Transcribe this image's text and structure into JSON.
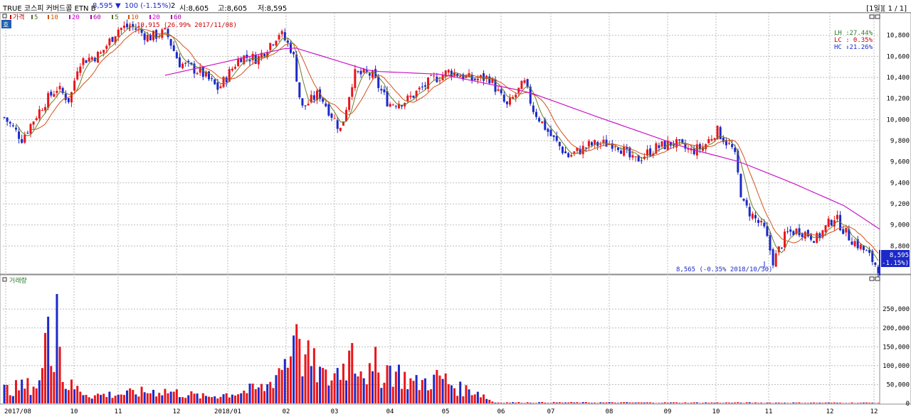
{
  "header": {
    "name": "TRUE 코스피 커버드콜 ETN B",
    "price": "8,595",
    "change_arrow": "▼",
    "change": "100 (-1.15%)",
    "count": "2",
    "open": "시:8,605",
    "high": "고:8,605",
    "low": "저:8,595",
    "period": "[1일][ 1 / 1]"
  },
  "price_panel": {
    "legend": [
      {
        "label": "가격",
        "color": "#cc0000"
      },
      {
        "label": "5",
        "color": "#556b2f"
      },
      {
        "label": "10",
        "color": "#cc5500"
      },
      {
        "label": "20",
        "color": "#cc00cc"
      },
      {
        "label": "60",
        "color": "#aa00aa"
      },
      {
        "label": "5",
        "color": "#556b2f"
      },
      {
        "label": "10",
        "color": "#cc5500"
      },
      {
        "label": "20",
        "color": "#cc00cc"
      },
      {
        "label": "60",
        "color": "#aa00aa"
      }
    ],
    "small_button": "호",
    "stats": {
      "lh_label": "LH :",
      "lh_value": "27.44%",
      "lc_label": "LC :",
      "lc_value": "0.35%",
      "hc_label": "HC :",
      "hc_value": "-21.26%"
    },
    "high_annotation": "10,915 (26.99% 2017/11/08)",
    "low_annotation": "8,565 (-0.35% 2018/10/30)",
    "current_price_label": "8,595",
    "current_change_label": "(-1.15%)"
  },
  "volume_panel": {
    "title": "거래량"
  },
  "colors": {
    "up": "#e8161b",
    "down": "#1c29c8",
    "ma5": "#6b7d2a",
    "ma10": "#d2531b",
    "ma60": "#c815c8"
  },
  "chart_data": {
    "type": "candlestick",
    "price_axis": {
      "ticks": [
        8800,
        9000,
        9200,
        9400,
        9600,
        9800,
        10000,
        10200,
        10400,
        10600,
        10800
      ],
      "range": [
        8560,
        10960
      ]
    },
    "volume_axis": {
      "ticks": [
        0,
        50000,
        100000,
        150000,
        200000,
        250000
      ],
      "range": [
        0,
        290000
      ]
    },
    "x_labels": [
      "2017/08",
      "10",
      "11",
      "12",
      "2018/01",
      "02",
      "03",
      "04",
      "05",
      "06",
      "07",
      "08",
      "09",
      "10",
      "11",
      "12",
      "12"
    ],
    "price_path": [
      {
        "t": 0,
        "v": 10020
      },
      {
        "t": 0.02,
        "v": 9820
      },
      {
        "t": 0.045,
        "v": 10150
      },
      {
        "t": 0.06,
        "v": 10300
      },
      {
        "t": 0.075,
        "v": 10180
      },
      {
        "t": 0.085,
        "v": 10550
      },
      {
        "t": 0.11,
        "v": 10620
      },
      {
        "t": 0.13,
        "v": 10860
      },
      {
        "t": 0.145,
        "v": 10890
      },
      {
        "t": 0.165,
        "v": 10780
      },
      {
        "t": 0.185,
        "v": 10830
      },
      {
        "t": 0.2,
        "v": 10540
      },
      {
        "t": 0.225,
        "v": 10450
      },
      {
        "t": 0.245,
        "v": 10290
      },
      {
        "t": 0.27,
        "v": 10600
      },
      {
        "t": 0.29,
        "v": 10580
      },
      {
        "t": 0.315,
        "v": 10830
      },
      {
        "t": 0.33,
        "v": 10650
      },
      {
        "t": 0.34,
        "v": 10100
      },
      {
        "t": 0.36,
        "v": 10250
      },
      {
        "t": 0.385,
        "v": 9900
      },
      {
        "t": 0.4,
        "v": 10430
      },
      {
        "t": 0.42,
        "v": 10430
      },
      {
        "t": 0.44,
        "v": 10150
      },
      {
        "t": 0.46,
        "v": 10180
      },
      {
        "t": 0.49,
        "v": 10380
      },
      {
        "t": 0.51,
        "v": 10460
      },
      {
        "t": 0.535,
        "v": 10380
      },
      {
        "t": 0.555,
        "v": 10400
      },
      {
        "t": 0.575,
        "v": 10120
      },
      {
        "t": 0.595,
        "v": 10350
      },
      {
        "t": 0.605,
        "v": 10100
      },
      {
        "t": 0.625,
        "v": 9850
      },
      {
        "t": 0.645,
        "v": 9650
      },
      {
        "t": 0.67,
        "v": 9760
      },
      {
        "t": 0.7,
        "v": 9780
      },
      {
        "t": 0.72,
        "v": 9600
      },
      {
        "t": 0.745,
        "v": 9730
      },
      {
        "t": 0.765,
        "v": 9780
      },
      {
        "t": 0.785,
        "v": 9700
      },
      {
        "t": 0.8,
        "v": 9740
      },
      {
        "t": 0.815,
        "v": 9900
      },
      {
        "t": 0.835,
        "v": 9700
      },
      {
        "t": 0.845,
        "v": 9200
      },
      {
        "t": 0.87,
        "v": 8950
      },
      {
        "t": 0.88,
        "v": 8650
      },
      {
        "t": 0.895,
        "v": 8920
      },
      {
        "t": 0.91,
        "v": 8950
      },
      {
        "t": 0.93,
        "v": 8870
      },
      {
        "t": 0.95,
        "v": 9080
      },
      {
        "t": 0.965,
        "v": 8900
      },
      {
        "t": 0.985,
        "v": 8750
      },
      {
        "t": 1.0,
        "v": 8595
      }
    ],
    "ma_slow_path": [
      {
        "t": 0.185,
        "v": 10420
      },
      {
        "t": 0.26,
        "v": 10560
      },
      {
        "t": 0.33,
        "v": 10690
      },
      {
        "t": 0.42,
        "v": 10460
      },
      {
        "t": 0.5,
        "v": 10430
      },
      {
        "t": 0.6,
        "v": 10260
      },
      {
        "t": 0.68,
        "v": 10020
      },
      {
        "t": 0.78,
        "v": 9730
      },
      {
        "t": 0.84,
        "v": 9600
      },
      {
        "t": 0.9,
        "v": 9400
      },
      {
        "t": 0.96,
        "v": 9180
      },
      {
        "t": 1.0,
        "v": 8960
      }
    ],
    "volume_profile": [
      {
        "t": 0,
        "v": 42000
      },
      {
        "t": 0.04,
        "v": 60000
      },
      {
        "t": 0.052,
        "v": 230000
      },
      {
        "t": 0.07,
        "v": 60000
      },
      {
        "t": 0.1,
        "v": 25000
      },
      {
        "t": 0.14,
        "v": 30000
      },
      {
        "t": 0.18,
        "v": 40000
      },
      {
        "t": 0.23,
        "v": 20000
      },
      {
        "t": 0.27,
        "v": 35000
      },
      {
        "t": 0.3,
        "v": 50000
      },
      {
        "t": 0.325,
        "v": 150000
      },
      {
        "t": 0.345,
        "v": 140000
      },
      {
        "t": 0.37,
        "v": 70000
      },
      {
        "t": 0.4,
        "v": 150000
      },
      {
        "t": 0.42,
        "v": 80000
      },
      {
        "t": 0.44,
        "v": 110000
      },
      {
        "t": 0.47,
        "v": 60000
      },
      {
        "t": 0.5,
        "v": 80000
      },
      {
        "t": 0.52,
        "v": 45000
      },
      {
        "t": 0.54,
        "v": 40000
      },
      {
        "t": 0.56,
        "v": 3000
      },
      {
        "t": 1.0,
        "v": 2000
      }
    ],
    "volume_spikes": [
      {
        "t": 0.051,
        "v": 230000
      },
      {
        "t": 0.061,
        "v": 290000
      },
      {
        "t": 0.063,
        "v": 150000
      },
      {
        "t": 0.335,
        "v": 210000
      },
      {
        "t": 0.332,
        "v": 180000
      },
      {
        "t": 0.398,
        "v": 160000
      },
      {
        "t": 0.425,
        "v": 150000
      },
      {
        "t": 0.396,
        "v": 140000
      }
    ]
  }
}
